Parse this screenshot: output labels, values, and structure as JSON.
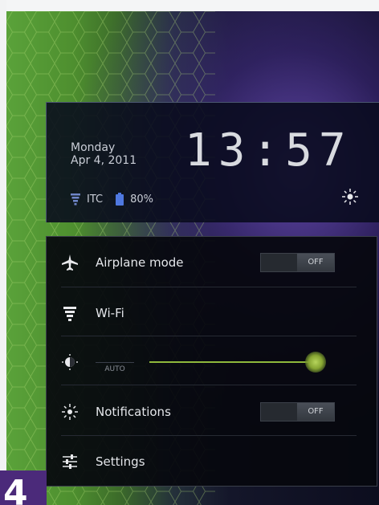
{
  "clock": {
    "day": "Monday",
    "date": "Apr 4, 2011",
    "time": "13:57"
  },
  "status": {
    "carrier": "ITC",
    "battery": "80%"
  },
  "menu": {
    "airplane_label": "Airplane mode",
    "airplane_toggle": "OFF",
    "wifi_label": "Wi-Fi",
    "brightness_auto": "AUTO",
    "brightness_level": 1.0,
    "notifications_label": "Notifications",
    "notifications_toggle": "OFF",
    "settings_label": "Settings"
  },
  "page_number": "4",
  "colors": {
    "accent": "#8fb83c",
    "page_badge": "#4b2a7a"
  },
  "icons": [
    "airplane-icon",
    "wifi-icon",
    "brightness-icon",
    "notifications-icon",
    "settings-icon",
    "signal-icon",
    "battery-icon"
  ]
}
